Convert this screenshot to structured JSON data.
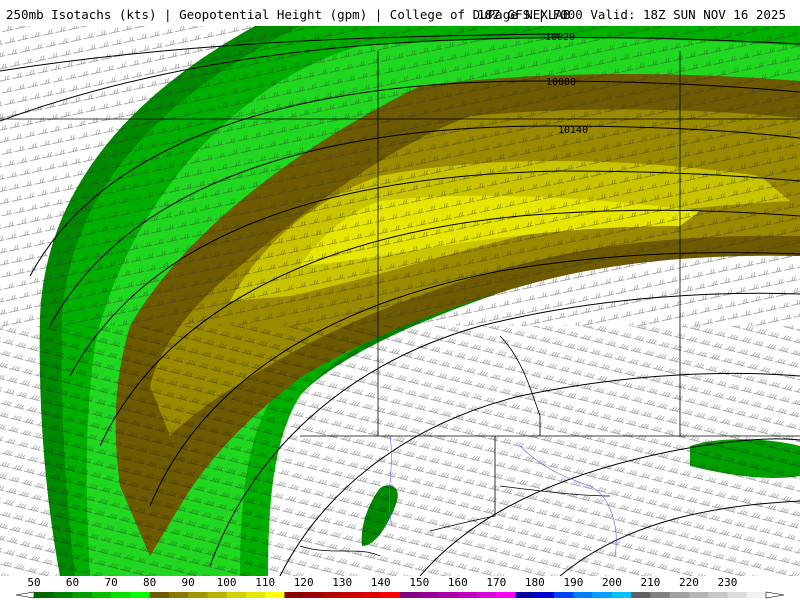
{
  "header": {
    "left": "250mb Isotachs (kts) | Geopotential Height (gpm) | College of DuPage NEXLAB",
    "right": "18Z GFS | F000 Valid: 18Z SUN NOV 16 2025"
  },
  "contour_labels": [
    "10020",
    "10080",
    "10140"
  ],
  "colorbar": {
    "labels": [
      "50",
      "60",
      "70",
      "80",
      "90",
      "100",
      "110",
      "120",
      "130",
      "140",
      "150",
      "160",
      "170",
      "180",
      "190",
      "200",
      "210",
      "220",
      "230"
    ],
    "colors": [
      "#006400",
      "#008000",
      "#00a000",
      "#00c000",
      "#00e000",
      "#00ff00",
      "#6e5a00",
      "#8c7800",
      "#a09600",
      "#b4b400",
      "#d2d200",
      "#e6e600",
      "#ffff00",
      "#8b0000",
      "#a00000",
      "#b40000",
      "#c80000",
      "#dc0000",
      "#ff0000",
      "#800080",
      "#960096",
      "#aa00aa",
      "#c000c0",
      "#d800d8",
      "#ff00ff",
      "#0000a0",
      "#0000d0",
      "#0040ff",
      "#0080ff",
      "#00a0ff",
      "#00c0ff",
      "#606060",
      "#808080",
      "#a0a0a0",
      "#b4b4b4",
      "#c8c8c8",
      "#dcdcdc",
      "#f0f0f0"
    ]
  }
}
